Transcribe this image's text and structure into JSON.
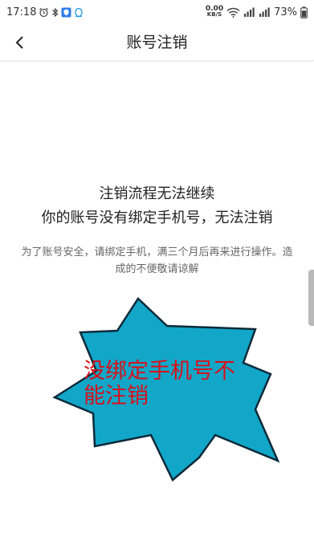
{
  "status_bar": {
    "time": "17:18",
    "speed_value": "0.00",
    "speed_unit": "KB/S",
    "battery": "73%"
  },
  "header": {
    "title": "账号注销"
  },
  "message": {
    "line1": "注销流程无法继续",
    "line2": "你的账号没有绑定手机号，无法注销",
    "description": "为了账号安全，请绑定手机，满三个月后再来进行操作。造成的不便敬请谅解"
  },
  "annotation": {
    "text": "没绑定手机号不能注销",
    "fill_color": "#12a7c8",
    "text_color": "#d8101a"
  }
}
